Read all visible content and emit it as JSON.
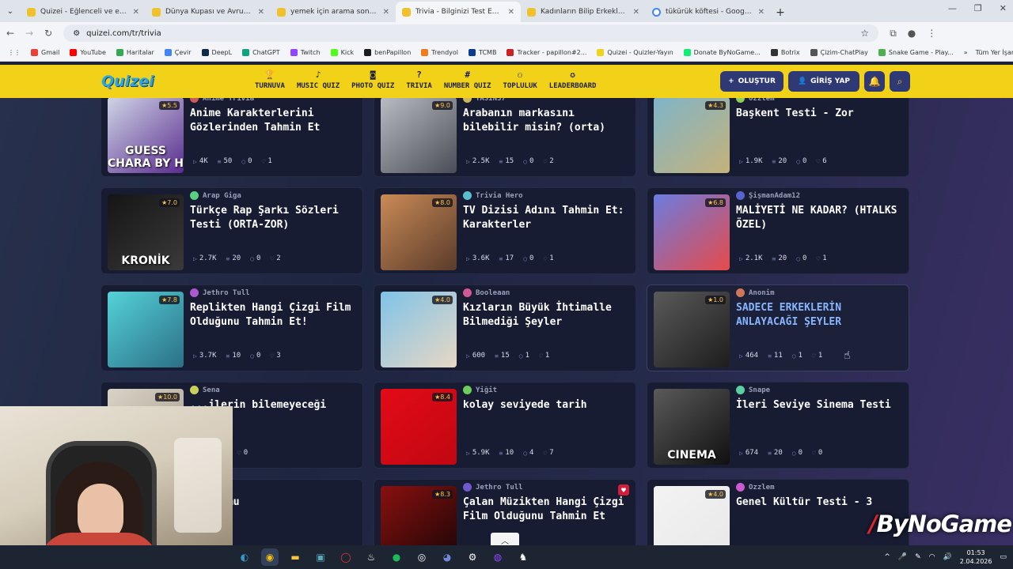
{
  "browser": {
    "tabs": [
      {
        "title": "Quizei - Eğlenceli ve etkileşimli",
        "active": false
      },
      {
        "title": "Dünya Kupası ve Avrupa Şampi",
        "active": false
      },
      {
        "title": "yemek için arama sonuçları - Q",
        "active": false
      },
      {
        "title": "Trivia - Bilginizi Test Edin - Quiz",
        "active": true
      },
      {
        "title": "Kadınların Bilip Erkeklerin Bilme",
        "active": false
      },
      {
        "title": "tükürük köftesi - Google'da Ara",
        "active": false
      }
    ],
    "url": "quizei.com/tr/trivia",
    "bookmarks": [
      "Gmail",
      "YouTube",
      "Haritalar",
      "Çevir",
      "DeepL",
      "ChatGPT",
      "Twitch",
      "Kick",
      "benPapillon",
      "Trendyol",
      "TCMB",
      "Tracker - papillon#2...",
      "Quizei - Quizler-Yayın",
      "Donate ByNoGame...",
      "Botrix",
      "Çizim-ChatPlay",
      "Snake Game - Play..."
    ],
    "bookmarks_more": "»",
    "all_bookmarks": "Tüm Yer İşaretleri"
  },
  "site": {
    "logo": "Quizei",
    "nav": [
      {
        "label": "TURNUVA",
        "icon": "trophy"
      },
      {
        "label": "MUSIC QUIZ",
        "icon": "music"
      },
      {
        "label": "PHOTO QUIZ",
        "icon": "camera"
      },
      {
        "label": "TRIVIA",
        "icon": "question"
      },
      {
        "label": "NUMBER QUIZ",
        "icon": "hash"
      },
      {
        "label": "TOPLULUK",
        "icon": "users"
      },
      {
        "label": "LEADERBOARD",
        "icon": "medal"
      }
    ],
    "create_label": "OLUŞTUR",
    "login_label": "GİRİŞ YAP"
  },
  "quizzes": [
    {
      "author": "Anime Trivia",
      "title": "Anime Karakterlerini Gözlerinden Tahmin Et",
      "rating": "5.5",
      "plays": "4K",
      "questions": "50",
      "comments": "0",
      "likes": "1",
      "thumb_text": "GUESS CHARA BY H",
      "colors": [
        "#cfd5e6",
        "#5a2c8f"
      ]
    },
    {
      "author": "YASİN37",
      "title": "Arabanın markasını bilebilir misin? (orta)",
      "rating": "9.0",
      "plays": "2.5K",
      "questions": "15",
      "comments": "0",
      "likes": "2",
      "thumb_text": "",
      "colors": [
        "#b9bcc2",
        "#4a4d55"
      ]
    },
    {
      "author": "Ozzlem",
      "title": "Başkent Testi - Zor",
      "rating": "4.3",
      "plays": "1.9K",
      "questions": "20",
      "comments": "0",
      "likes": "6",
      "thumb_text": "",
      "colors": [
        "#7fb4c9",
        "#c5b27a"
      ]
    },
    {
      "author": "Arap Giga",
      "title": "Türkçe Rap Şarkı Sözleri Testi (ORTA-ZOR)",
      "rating": "7.0",
      "plays": "2.7K",
      "questions": "20",
      "comments": "0",
      "likes": "2",
      "thumb_text": "KRONİK",
      "colors": [
        "#151515",
        "#3a3a3a"
      ]
    },
    {
      "author": "Trivia Hero",
      "title": "TV Dizisi Adını Tahmin Et: Karakterler",
      "rating": "8.0",
      "plays": "3.6K",
      "questions": "17",
      "comments": "0",
      "likes": "1",
      "thumb_text": "",
      "colors": [
        "#c98a56",
        "#5a3b2a"
      ]
    },
    {
      "author": "ŞişmanAdam12",
      "title": "MALİYETİ NE KADAR? (HTALKS ÖZEL)",
      "rating": "6.8",
      "plays": "2.1K",
      "questions": "20",
      "comments": "0",
      "likes": "1",
      "thumb_text": "",
      "colors": [
        "#6b7ce0",
        "#e64a4a"
      ]
    },
    {
      "author": "Jethro Tull",
      "title": "Replikten Hangi Çizgi Film Olduğunu Tahmin Et!",
      "rating": "7.8",
      "plays": "3.7K",
      "questions": "10",
      "comments": "0",
      "likes": "3",
      "thumb_text": "",
      "colors": [
        "#54d2d8",
        "#2c6f86"
      ]
    },
    {
      "author": "Booleaan",
      "title": "Kızların Büyük İhtimalle Bilmediği Şeyler",
      "rating": "4.0",
      "plays": "600",
      "questions": "15",
      "comments": "1",
      "likes": "1",
      "thumb_text": "",
      "colors": [
        "#7fc3e8",
        "#e8d7c4"
      ]
    },
    {
      "author": "Anonim",
      "title": "SADECE ERKEKLERİN ANLAYACAĞI ŞEYLER",
      "rating": "1.0",
      "plays": "464",
      "questions": "11",
      "comments": "1",
      "likes": "1",
      "thumb_text": "",
      "colors": [
        "#5a5a5a",
        "#1d1d1d"
      ],
      "highlight": true
    },
    {
      "author": "Sena",
      "title": "...ilerin bilemeyeceği",
      "rating": "10.0",
      "plays": "",
      "questions": "16",
      "comments": "0",
      "likes": "0",
      "thumb_text": "",
      "colors": [
        "#d9d3c7",
        "#a49b8c"
      ]
    },
    {
      "author": "Yiğit",
      "title": "kolay seviyede tarih",
      "rating": "8.4",
      "plays": "5.9K",
      "questions": "10",
      "comments": "4",
      "likes": "7",
      "thumb_text": "",
      "colors": [
        "#e30a17",
        "#c00812"
      ]
    },
    {
      "author": "Snape",
      "title": "İleri Seviye Sinema Testi",
      "rating": "",
      "plays": "674",
      "questions": "20",
      "comments": "0",
      "likes": "0",
      "thumb_text": "CINEMA",
      "colors": [
        "#5a5a5a",
        "#101010"
      ]
    },
    {
      "author": "",
      "title": "...ok mu",
      "rating": "",
      "plays": "",
      "questions": "",
      "comments": "",
      "likes": "",
      "thumb_text": "",
      "colors": [
        "#2a2a3a",
        "#1a1a2a"
      ]
    },
    {
      "author": "Jethro Tull",
      "title": "Çalan Müzikten Hangi Çizgi Film Olduğunu Tahmin Et",
      "rating": "8.3",
      "plays": "",
      "questions": "",
      "comments": "",
      "likes": "",
      "thumb_text": "",
      "colors": [
        "#8a1010",
        "#1a0505"
      ],
      "badge": true
    },
    {
      "author": "Ozzlem",
      "title": "Genel Kültür Testi - 3",
      "rating": "4.0",
      "plays": "",
      "questions": "",
      "comments": "",
      "likes": "",
      "thumb_text": "QUIZ",
      "colors": [
        "#f3f3f3",
        "#e8e8e8"
      ]
    }
  ],
  "taskbar": {
    "time": "01:53",
    "date": "2.04.2026"
  },
  "watermark": {
    "prefix": "/",
    "text": "ByNoGame"
  }
}
